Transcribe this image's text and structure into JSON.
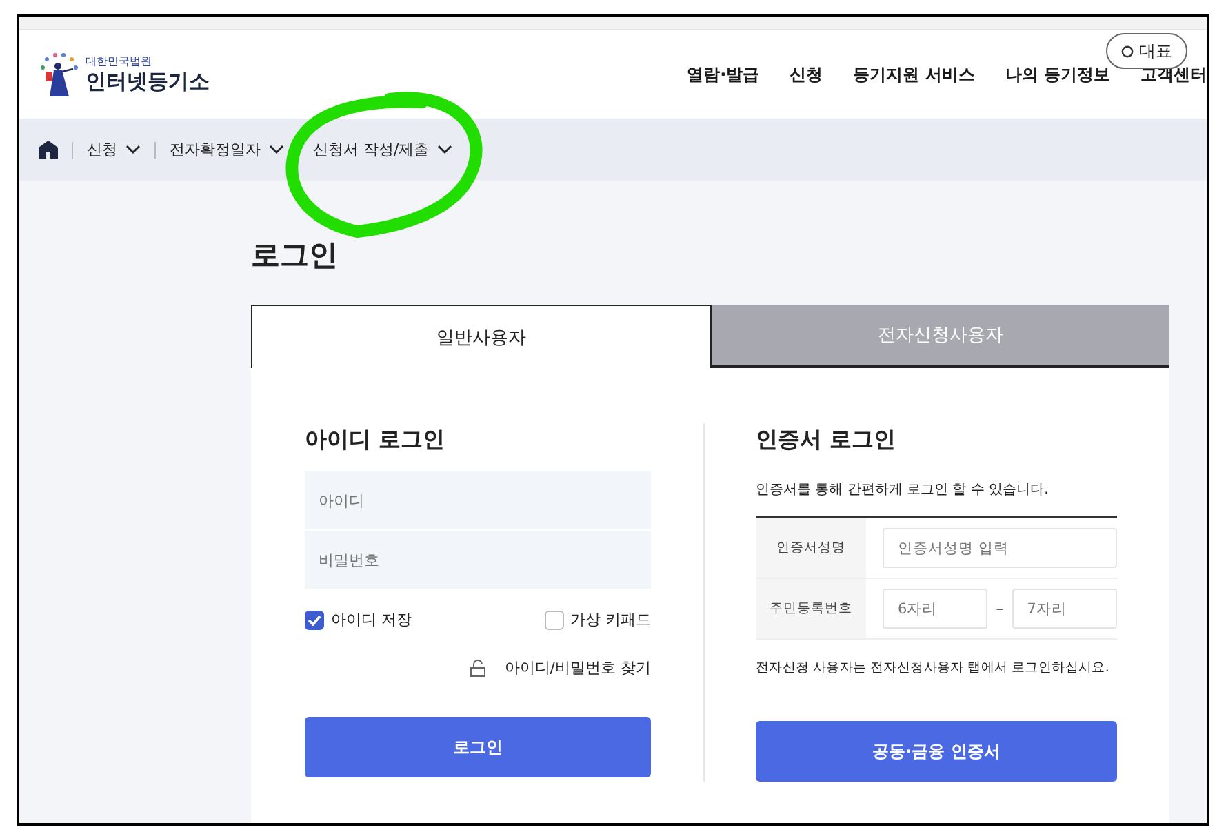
{
  "header": {
    "logo_subtitle": "대한민국법원",
    "logo_title": "인터넷등기소",
    "nav": [
      "열람·발급",
      "신청",
      "등기지원 서비스",
      "나의 등기정보",
      "고객센터"
    ],
    "rep_button": "대표"
  },
  "breadcrumb": [
    "신청",
    "전자확정일자",
    "신청서 작성/제출"
  ],
  "page_title": "로그인",
  "tabs": [
    {
      "label": "일반사용자",
      "selected": true
    },
    {
      "label": "전자신청사용자",
      "selected": false
    }
  ],
  "id_login": {
    "title": "아이디 로그인",
    "fields": [
      {
        "placeholder": "아이디"
      },
      {
        "placeholder": "비밀번호"
      }
    ],
    "options": [
      {
        "label": "아이디 저장",
        "checked": true
      },
      {
        "label": "가상 키패드",
        "checked": false
      }
    ],
    "find_link": "아이디/비밀번호 찾기",
    "button": "로그인"
  },
  "cert_login": {
    "title": "인증서 로그인",
    "description": "인증서를 통해 간편하게 로그인 할 수 있습니다.",
    "rows": [
      {
        "label": "인증서성명",
        "fields": [
          {
            "placeholder": "인증서성명 입력"
          }
        ]
      },
      {
        "label": "주민등록번호",
        "separator": "–",
        "fields": [
          {
            "placeholder": "6자리"
          },
          {
            "placeholder": "7자리"
          }
        ]
      }
    ],
    "note": "전자신청 사용자는 전자신청사용자 탭에서 로그인하십시요.",
    "button": "공동·금융 인증서"
  }
}
